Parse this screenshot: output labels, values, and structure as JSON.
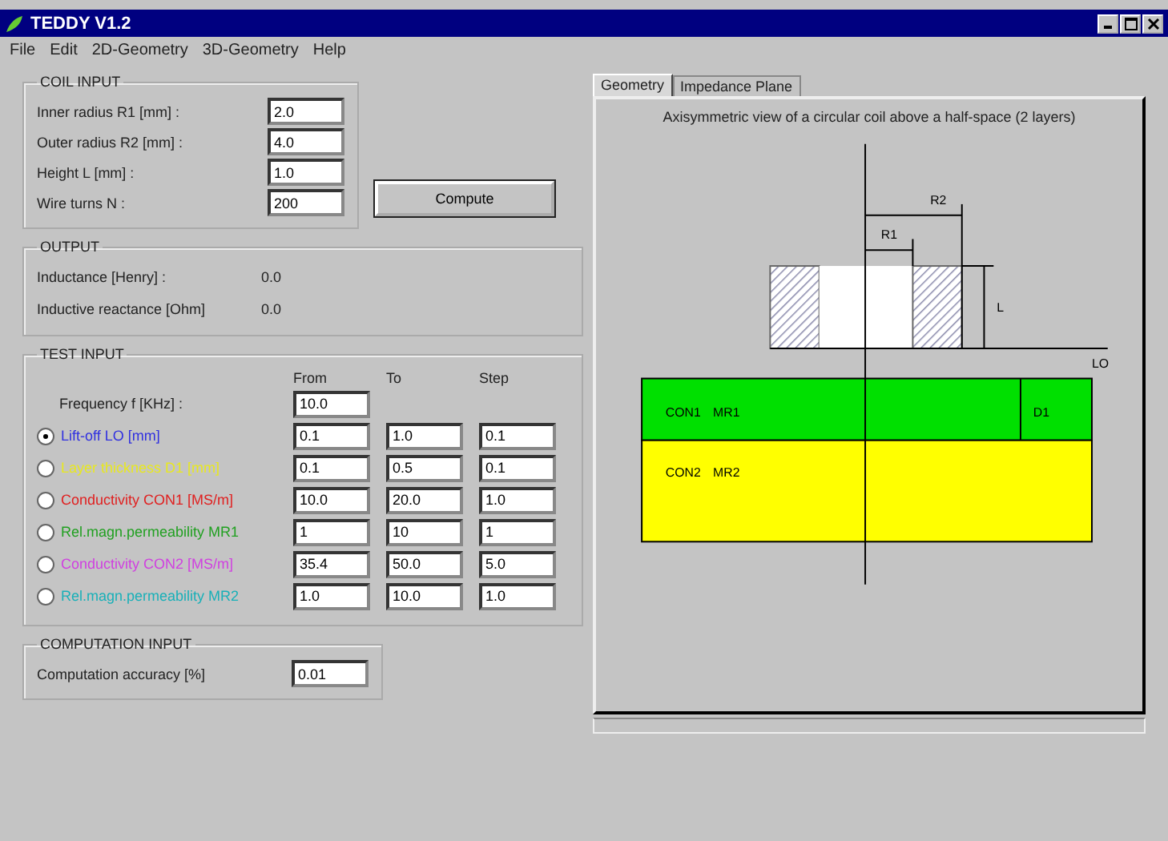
{
  "window": {
    "title": "TEDDY V1.2"
  },
  "menu": [
    "File",
    "Edit",
    "2D-Geometry",
    "3D-Geometry",
    "Help"
  ],
  "coil_input": {
    "title": "COIL INPUT",
    "fields": [
      {
        "label": "Inner radius R1 [mm] :",
        "value": "2.0"
      },
      {
        "label": "Outer radius R2 [mm] :",
        "value": "4.0"
      },
      {
        "label": "Height L [mm] :",
        "value": "1.0"
      },
      {
        "label": "Wire turns N :",
        "value": "200"
      }
    ]
  },
  "compute_button": "Compute",
  "output": {
    "title": "OUTPUT",
    "rows": [
      {
        "label": "Inductance [Henry] :",
        "value": "0.0"
      },
      {
        "label": "Inductive reactance [Ohm]",
        "value": "0.0"
      }
    ]
  },
  "test_input": {
    "title": "TEST INPUT",
    "columns": [
      "From",
      "To",
      "Step"
    ],
    "rows": [
      {
        "kind": "fixed",
        "label": "Frequency f [KHz] :",
        "from": "10.0"
      },
      {
        "kind": "sweep",
        "label": "Lift-off LO [mm]",
        "color": "#3030e0",
        "selected": true,
        "from": "0.1",
        "to": "1.0",
        "step": "0.1"
      },
      {
        "kind": "sweep",
        "label": "Layer thickness D1 [mm]",
        "color": "#e8e820",
        "selected": false,
        "from": "0.1",
        "to": "0.5",
        "step": "0.1"
      },
      {
        "kind": "sweep",
        "label": "Conductivity CON1 [MS/m]",
        "color": "#e02020",
        "selected": false,
        "from": "10.0",
        "to": "20.0",
        "step": "1.0"
      },
      {
        "kind": "sweep",
        "label": "Rel.magn.permeability MR1",
        "color": "#20a020",
        "selected": false,
        "from": "1",
        "to": "10",
        "step": "1"
      },
      {
        "kind": "sweep",
        "label": "Conductivity CON2 [MS/m]",
        "color": "#d040e0",
        "selected": false,
        "from": "35.4",
        "to": "50.0",
        "step": "5.0"
      },
      {
        "kind": "sweep",
        "label": "Rel.magn.permeability MR2",
        "color": "#18b0b8",
        "selected": false,
        "from": "1.0",
        "to": "10.0",
        "step": "1.0"
      }
    ]
  },
  "computation_input": {
    "title": "COMPUTATION INPUT",
    "label": "Computation accuracy [%]",
    "value": "0.01"
  },
  "tabs": [
    {
      "label": "Geometry",
      "selected": true
    },
    {
      "label": "Impedance Plane",
      "selected": false
    }
  ],
  "geometry": {
    "caption": "Axisymmetric view of a circular coil above a half-space (2 layers)",
    "labels": {
      "r2": "R2",
      "r1": "R1",
      "l": "L",
      "lo": "LO",
      "d1": "D1"
    },
    "layers": [
      {
        "label1": "CON1",
        "label2": "MR1",
        "color": "#00e000"
      },
      {
        "label1": "CON2",
        "label2": "MR2",
        "color": "#ffff00"
      }
    ]
  }
}
